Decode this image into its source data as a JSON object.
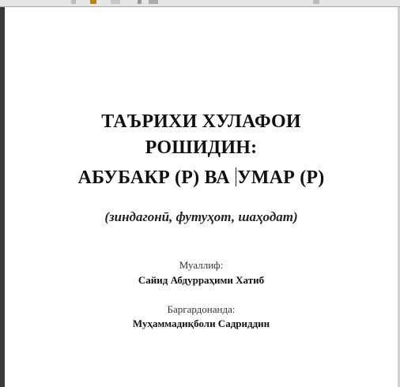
{
  "document": {
    "title_line1": "ТАЪРИХИ ХУЛАФОИ",
    "title_line2": "РОШИДИН:",
    "title_line3_a": "АБУБАКР (Р) ВА ",
    "title_line3_b": "УМАР (Р)",
    "subtitle": "(зиндагонӣ, футуҳот, шаҳодат)",
    "author_label": "Муаллиф:",
    "author_name": "Сайид Абдурраҳими Хатиб",
    "translator_label": "Баргардонанда:",
    "translator_name": "Муҳаммадиқболи Садриддин"
  },
  "toolbar": {
    "icons": [
      "page-icon",
      "bookmark-icon",
      "selection-icon",
      "pointer-icon",
      "grid-icon",
      "right-tool-icon"
    ]
  }
}
